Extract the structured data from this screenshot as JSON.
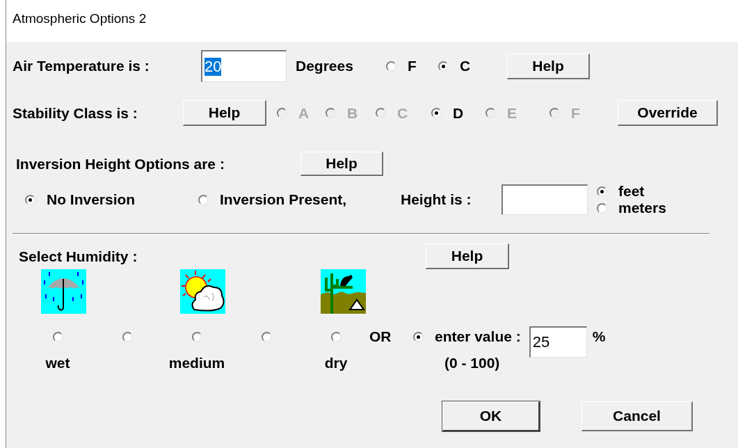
{
  "window": {
    "title": "Atmospheric Options 2"
  },
  "temperature": {
    "label": "Air Temperature is :",
    "value": "20",
    "value_highlighted": true,
    "units_label": "Degrees",
    "units": [
      {
        "label": "F",
        "selected": false
      },
      {
        "label": "C",
        "selected": true
      }
    ],
    "help": "Help"
  },
  "stability": {
    "label": "Stability Class is :",
    "help": "Help",
    "classes": [
      {
        "label": "A",
        "selected": false,
        "disabled": true
      },
      {
        "label": "B",
        "selected": false,
        "disabled": true
      },
      {
        "label": "C",
        "selected": false,
        "disabled": true
      },
      {
        "label": "D",
        "selected": true,
        "disabled": false
      },
      {
        "label": "E",
        "selected": false,
        "disabled": true
      },
      {
        "label": "F",
        "selected": false,
        "disabled": true
      }
    ],
    "override": "Override"
  },
  "inversion": {
    "label": "Inversion Height Options are :",
    "help": "Help",
    "options": [
      {
        "label": "No Inversion",
        "selected": true
      },
      {
        "label": "Inversion Present,",
        "selected": false
      }
    ],
    "height_label": "Height is :",
    "units": [
      {
        "label": "feet",
        "selected": true
      },
      {
        "label": "meters",
        "selected": false
      }
    ]
  },
  "humidity": {
    "label": "Select Humidity :",
    "help": "Help",
    "levels": [
      {
        "label": "wet",
        "selected": false
      },
      {
        "selected": false
      },
      {
        "label": "medium",
        "selected": false
      },
      {
        "selected": false
      },
      {
        "label": "dry",
        "selected": false
      }
    ],
    "or_label": "OR",
    "custom": {
      "selected": true,
      "label": "enter value :",
      "range": "(0 - 100)",
      "value": "25",
      "unit": "%"
    }
  },
  "buttons": [
    {
      "label": "OK",
      "default": true
    },
    {
      "label": "Cancel",
      "default": false
    }
  ]
}
